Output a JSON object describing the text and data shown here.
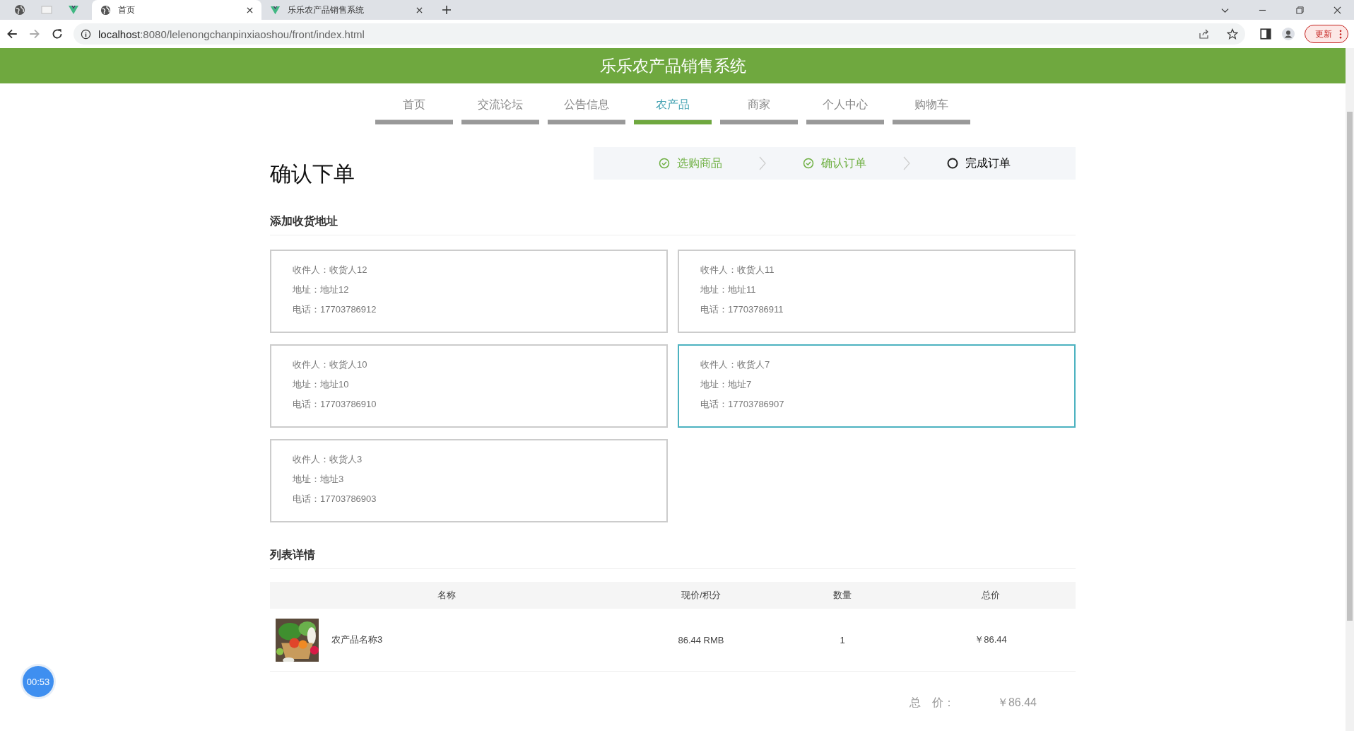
{
  "browser": {
    "tabs": [
      {
        "title": "首页",
        "kind": "site",
        "selected": true
      },
      {
        "title": "乐乐农产品销售系统",
        "kind": "app",
        "selected": false
      }
    ],
    "url_host": "localhost",
    "url_rest": ":8080/lelenongchanpinxiaoshou/front/index.html",
    "update_button": "更新"
  },
  "site_title": "乐乐农产品销售系统",
  "nav": [
    {
      "label": "首页",
      "selected": false
    },
    {
      "label": "交流论坛",
      "selected": false
    },
    {
      "label": "公告信息",
      "selected": false
    },
    {
      "label": "农产品",
      "selected": true
    },
    {
      "label": "商家",
      "selected": false
    },
    {
      "label": "个人中心",
      "selected": false
    },
    {
      "label": "购物车",
      "selected": false
    }
  ],
  "page_title": "确认下单",
  "steps": [
    {
      "label": "选购商品",
      "done": true
    },
    {
      "label": "确认订单",
      "done": true
    },
    {
      "label": "完成订单",
      "done": false
    }
  ],
  "address_section": {
    "title": "添加收货地址",
    "addresses": [
      {
        "recipient": "收件人：收货人12",
        "address": "地址：地址12",
        "phone": "电话：17703786912",
        "selected": false
      },
      {
        "recipient": "收件人：收货人11",
        "address": "地址：地址11",
        "phone": "电话：17703786911",
        "selected": false
      },
      {
        "recipient": "收件人：收货人10",
        "address": "地址：地址10",
        "phone": "电话：17703786910",
        "selected": false
      },
      {
        "recipient": "收件人：收货人7",
        "address": "地址：地址7",
        "phone": "电话：17703786907",
        "selected": true
      },
      {
        "recipient": "收件人：收货人3",
        "address": "地址：地址3",
        "phone": "电话：17703786903",
        "selected": false
      }
    ]
  },
  "details": {
    "title": "列表详情",
    "columns": [
      "名称",
      "现价/积分",
      "数量",
      "总价"
    ],
    "rows": [
      {
        "name": "农产品名称3",
        "price": "86.44 RMB",
        "quantity": "1",
        "total": "￥86.44"
      }
    ],
    "totals": [
      {
        "label": "总　价：",
        "value": "￥86.44"
      }
    ]
  },
  "timer": "00:53"
}
